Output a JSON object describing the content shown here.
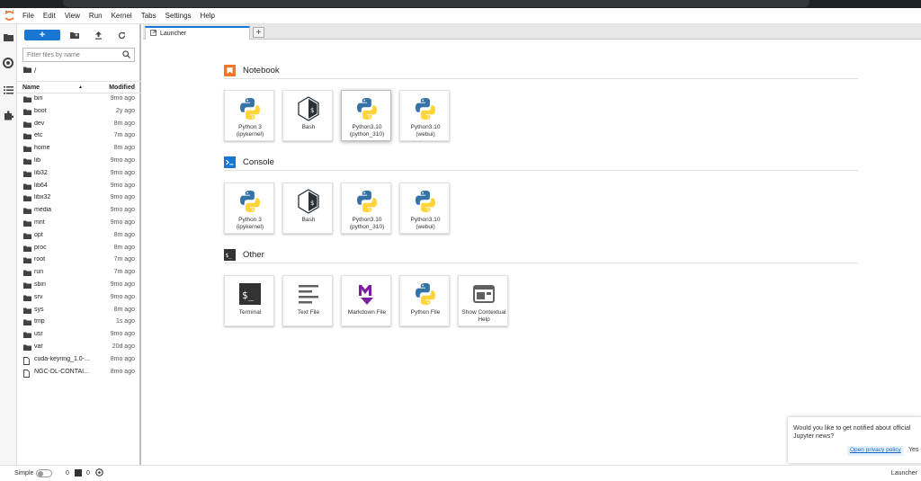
{
  "menu": [
    "File",
    "Edit",
    "View",
    "Run",
    "Kernel",
    "Tabs",
    "Settings",
    "Help"
  ],
  "filebrowser": {
    "new_label": "+",
    "filter_placeholder": "Filter files by name",
    "breadcrumb": "/",
    "col_name": "Name",
    "col_modified": "Modified",
    "files": [
      {
        "name": "bin",
        "modified": "9mo ago",
        "type": "folder"
      },
      {
        "name": "boot",
        "modified": "2y ago",
        "type": "folder"
      },
      {
        "name": "dev",
        "modified": "8m ago",
        "type": "folder"
      },
      {
        "name": "etc",
        "modified": "7m ago",
        "type": "folder"
      },
      {
        "name": "home",
        "modified": "8m ago",
        "type": "folder"
      },
      {
        "name": "lib",
        "modified": "9mo ago",
        "type": "folder"
      },
      {
        "name": "lib32",
        "modified": "9mo ago",
        "type": "folder"
      },
      {
        "name": "lib64",
        "modified": "9mo ago",
        "type": "folder"
      },
      {
        "name": "libx32",
        "modified": "9mo ago",
        "type": "folder"
      },
      {
        "name": "media",
        "modified": "9mo ago",
        "type": "folder"
      },
      {
        "name": "mnt",
        "modified": "9mo ago",
        "type": "folder"
      },
      {
        "name": "opt",
        "modified": "8m ago",
        "type": "folder"
      },
      {
        "name": "proc",
        "modified": "8m ago",
        "type": "folder"
      },
      {
        "name": "root",
        "modified": "7m ago",
        "type": "folder"
      },
      {
        "name": "run",
        "modified": "7m ago",
        "type": "folder"
      },
      {
        "name": "sbin",
        "modified": "9mo ago",
        "type": "folder"
      },
      {
        "name": "srv",
        "modified": "9mo ago",
        "type": "folder"
      },
      {
        "name": "sys",
        "modified": "8m ago",
        "type": "folder"
      },
      {
        "name": "tmp",
        "modified": "1s ago",
        "type": "folder"
      },
      {
        "name": "usr",
        "modified": "9mo ago",
        "type": "folder"
      },
      {
        "name": "var",
        "modified": "20d ago",
        "type": "folder"
      },
      {
        "name": "cuda-keyring_1.0-...",
        "modified": "8mo ago",
        "type": "file"
      },
      {
        "name": "NGC-DL-CONTAI...",
        "modified": "8mo ago",
        "type": "file"
      }
    ]
  },
  "tabs": {
    "active_label": "Launcher",
    "add_label": "+"
  },
  "launcher": {
    "notebook": {
      "title": "Notebook",
      "cards": [
        {
          "l1": "Python 3",
          "l2": "(ipykernel)",
          "icon": "python-icon"
        },
        {
          "l1": "Bash",
          "l2": "",
          "icon": "bash-icon"
        },
        {
          "l1": "Python3.10",
          "l2": "(python_310)",
          "icon": "python-icon"
        },
        {
          "l1": "Python3.10",
          "l2": "(webui)",
          "icon": "python-icon"
        }
      ]
    },
    "console": {
      "title": "Console",
      "cards": [
        {
          "l1": "Python 3",
          "l2": "(ipykernel)",
          "icon": "python-icon"
        },
        {
          "l1": "Bash",
          "l2": "",
          "icon": "bash-icon"
        },
        {
          "l1": "Python3.10",
          "l2": "(python_310)",
          "icon": "python-icon"
        },
        {
          "l1": "Python3.10",
          "l2": "(webui)",
          "icon": "python-icon"
        }
      ]
    },
    "other": {
      "title": "Other",
      "cards": [
        {
          "l1": "Terminal",
          "l2": "",
          "icon": "terminal-icon"
        },
        {
          "l1": "Text File",
          "l2": "",
          "icon": "text-file-icon"
        },
        {
          "l1": "Markdown File",
          "l2": "",
          "icon": "markdown-icon"
        },
        {
          "l1": "Python File",
          "l2": "",
          "icon": "python-icon"
        },
        {
          "l1": "Show Contextual",
          "l2": "Help",
          "icon": "contextual-help-icon"
        }
      ]
    }
  },
  "toast": {
    "message": "Would you like to get notified about official Jupyter news?",
    "privacy_label": "Open privacy policy",
    "yes_label": "Yes"
  },
  "status": {
    "simple_label": "Simple",
    "kernels_count": "0",
    "terminals_count": "0",
    "right_label": "Launcher"
  },
  "colors": {
    "accent": "#1976d2",
    "notebook_icon": "#f37726",
    "console_icon": "#1976d2",
    "python_blue": "#3572a5",
    "python_yellow": "#ffd43b",
    "markdown_purple": "#7b1fa2"
  }
}
